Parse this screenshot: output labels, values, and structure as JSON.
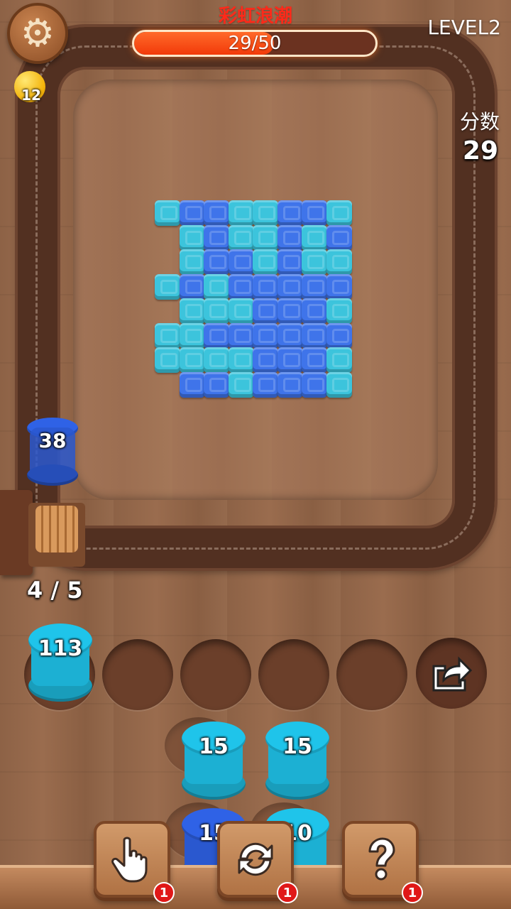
{
  "hud": {
    "event_title": "彩虹浪潮",
    "progress_text": "29/50",
    "progress_fraction": 0.58,
    "level": "LEVEL2",
    "coins": "12",
    "score_label": "分数",
    "score": "29"
  },
  "board": {
    "colors": {
      "dark": "#3f74ea",
      "light": "#3cc4dc"
    },
    "rows": [
      "LDDLLDDL",
      ".LDLLDLD",
      ".LDDLDLL",
      "LDLDDDDD",
      ".LLLDDDL",
      "LLDDDDDD",
      "LLLLDDDL",
      ".DDLDDDL"
    ]
  },
  "conveyor_spool": {
    "count": "38",
    "color": "#2f62e6"
  },
  "queue": {
    "counter": "4 / 5"
  },
  "slots": [
    {
      "count": "113",
      "color": "#1fc4ea"
    }
  ],
  "stack": [
    {
      "count": "15",
      "color": "#1fc4ea"
    },
    {
      "count": "15",
      "color": "#1fc4ea"
    },
    {
      "count": "15",
      "color": "#2f62e6"
    },
    {
      "count": "10",
      "color": "#1fc4ea"
    }
  ],
  "tools": [
    {
      "icon": "hand-pointer-icon",
      "badge": "1"
    },
    {
      "icon": "refresh-icon",
      "badge": "1"
    },
    {
      "icon": "question-icon",
      "badge": "1"
    }
  ]
}
